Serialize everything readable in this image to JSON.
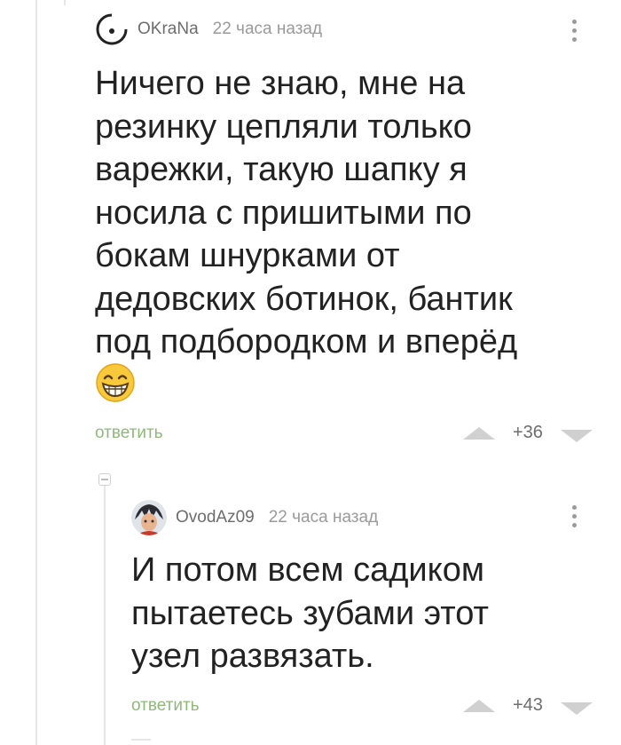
{
  "comments": [
    {
      "username": "OKraNa",
      "time": "22 часа назад",
      "text": "Ничего не знаю, мне на\nрезинку цепляли только\nварежки, такую шапку я\nносила с пришитыми по\nбокам шнурками от\nдедовских ботинок, бантик\nпод подбородком и вперёд",
      "reply_label": "ответить",
      "rating": "+36",
      "avatar_icon": "circle-avatar-icon",
      "emoji_icon": "grinning-face-icon"
    },
    {
      "username": "OvodAz09",
      "time": "22 часа назад",
      "text": "И потом всем садиком\nпытаетесь зубами этот\nузел развязать.",
      "reply_label": "ответить",
      "rating": "+43",
      "avatar_icon": "user-photo-avatar-icon"
    }
  ],
  "colors": {
    "reply_green": "#8fb87a",
    "text": "#222222",
    "meta_gray": "#9a9a9a",
    "vote_gray": "#d0d0d0"
  }
}
